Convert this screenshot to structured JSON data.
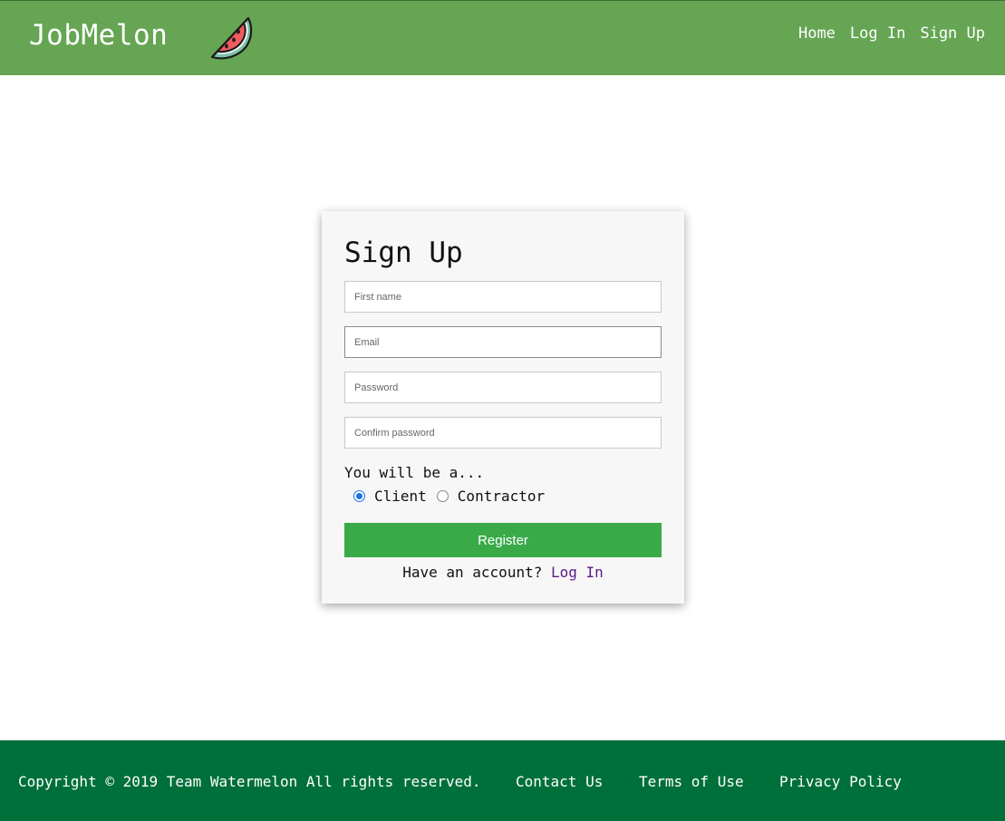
{
  "header": {
    "brand": "JobMelon",
    "logo_icon": "watermelon-slice-icon",
    "background_color": "#66a553",
    "nav": [
      {
        "label": "Home"
      },
      {
        "label": "Log In"
      },
      {
        "label": "Sign Up"
      }
    ]
  },
  "signup": {
    "title": "Sign Up",
    "fields": {
      "first_name": {
        "placeholder": "First name",
        "value": ""
      },
      "email": {
        "placeholder": "Email",
        "value": ""
      },
      "password": {
        "placeholder": "Password",
        "value": ""
      },
      "confirm_password": {
        "placeholder": "Confirm password",
        "value": ""
      }
    },
    "role_prompt": "You will be a...",
    "roles": [
      {
        "label": "Client",
        "selected": true
      },
      {
        "label": "Contractor",
        "selected": false
      }
    ],
    "register_label": "Register",
    "register_color": "#3aaa49",
    "account_prompt": "Have an account?",
    "login_link": "Log In"
  },
  "footer": {
    "copyright": "Copyright © 2019 Team Watermelon All rights reserved.",
    "links": [
      {
        "label": "Contact Us"
      },
      {
        "label": "Terms of Use"
      },
      {
        "label": "Privacy Policy"
      }
    ],
    "background_color": "#00703a"
  }
}
